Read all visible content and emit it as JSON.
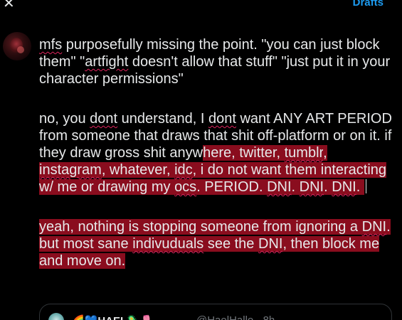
{
  "header": {
    "close_glyph": "✕",
    "drafts_label": "Drafts"
  },
  "colors": {
    "background": "#000000",
    "text": "#e7e9ea",
    "accent": "#1d9bf0",
    "selection": "#8a0d1e",
    "spell_underline": "#e0245e",
    "muted": "#71767b"
  },
  "compose": {
    "p1": {
      "s1": "mfs",
      "t1": " purposefully missing the point. \"you can just block them\" \"",
      "s2": "artfight",
      "t2": " doesn't allow that stuff\" \"just put it in your character permissions\""
    },
    "p2": {
      "t1": "no, you ",
      "s1": "dont",
      "t2": " understand, I ",
      "s2": "dont",
      "t3": " want ANY ART PERIOD from someone that draws that shit off-platform or on it. if they draw gross shit anyw",
      "h1": "here, twitter, ",
      "hs1": "tumblr",
      "h2": ", ",
      "hs2": "instagram",
      "h3": ", whatever, ",
      "hs3": "idc",
      "h4": ", i do not want them interacting w/ me or drawing my ",
      "hs4": "ocs",
      "h5": ". PERIOD. ",
      "hs5": "DNI",
      "h6": ". ",
      "hs6": "DNI",
      "h7": ". ",
      "hs7": "DNI",
      "h8": ". "
    },
    "p3": {
      "h1": "yeah, nothing is stopping someone from ignoring a ",
      "hs1": "DNI",
      "h2": ". but most sane ",
      "hs2": "indivuduals",
      "h3": " see the ",
      "hs3": "DNI",
      "h4": ", then block me and move on."
    }
  },
  "quote": {
    "name": "🌈💙HAEL🦠🌷",
    "handle": "@HaelHallo · 8h"
  }
}
